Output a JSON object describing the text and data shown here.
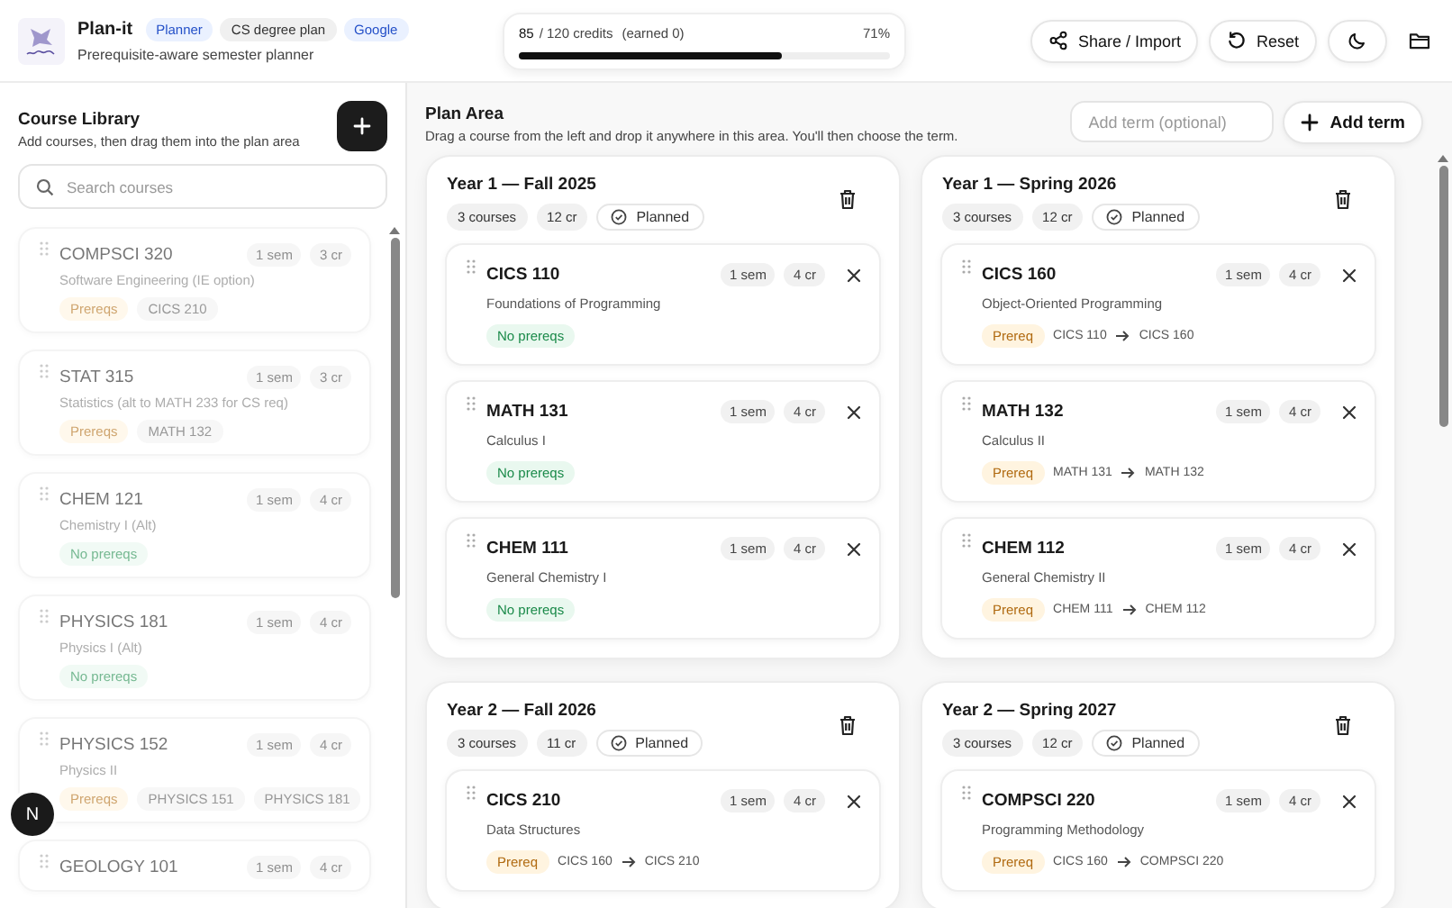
{
  "header": {
    "title": "Plan-it",
    "tags": [
      {
        "label": "Planner",
        "kind": "accent"
      },
      {
        "label": "CS degree plan",
        "kind": "plain"
      },
      {
        "label": "Google",
        "kind": "accent"
      }
    ],
    "subtitle": "Prerequisite-aware semester planner"
  },
  "credits": {
    "planned": "85",
    "total": "/ 120 credits",
    "earned": "(earned 0)",
    "percent": "71%",
    "level": 0.71
  },
  "actions": {
    "share": "Share / Import",
    "reset": "Reset"
  },
  "library": {
    "title": "Course Library",
    "subtitle": "Add courses, then drag them into the plan area",
    "search_placeholder": "Search courses",
    "courses": [
      {
        "code": "COMPSCI 320",
        "sem": "1 sem",
        "credits": "3 cr",
        "name": "Software Engineering (IE option)",
        "prereq": {
          "kind": "list",
          "label": "Prereqs",
          "items": [
            "CICS 210"
          ]
        }
      },
      {
        "code": "STAT 315",
        "sem": "1 sem",
        "credits": "3 cr",
        "name": "Statistics (alt to MATH 233 for CS req)",
        "prereq": {
          "kind": "list",
          "label": "Prereqs",
          "items": [
            "MATH 132"
          ]
        }
      },
      {
        "code": "CHEM 121",
        "sem": "1 sem",
        "credits": "4 cr",
        "name": "Chemistry I (Alt)",
        "prereq": {
          "kind": "none",
          "label": "No prereqs"
        }
      },
      {
        "code": "PHYSICS 181",
        "sem": "1 sem",
        "credits": "4 cr",
        "name": "Physics I (Alt)",
        "prereq": {
          "kind": "none",
          "label": "No prereqs"
        }
      },
      {
        "code": "PHYSICS 152",
        "sem": "1 sem",
        "credits": "4 cr",
        "name": "Physics II",
        "prereq": {
          "kind": "list",
          "label": "Prereqs",
          "items": [
            "PHYSICS 151",
            "PHYSICS 181"
          ]
        }
      },
      {
        "code": "GEOLOGY 101",
        "sem": "1 sem",
        "credits": "4 cr"
      }
    ]
  },
  "avatar": "N",
  "plan": {
    "title": "Plan Area",
    "subtitle": "Drag a course from the left and drop it anywhere in this area. You'll then choose the term.",
    "term_placeholder": "Add term (optional)",
    "add_term": "Add term",
    "terms": [
      {
        "title": "Year 1 — Fall 2025",
        "count": "3 courses",
        "credits": "12 cr",
        "status": "Planned",
        "courses": [
          {
            "code": "CICS 110",
            "sem": "1 sem",
            "credits": "4 cr",
            "name": "Foundations of Programming",
            "prereq": {
              "kind": "none",
              "label": "No prereqs"
            }
          },
          {
            "code": "MATH 131",
            "sem": "1 sem",
            "credits": "4 cr",
            "name": "Calculus I",
            "prereq": {
              "kind": "none",
              "label": "No prereqs"
            }
          },
          {
            "code": "CHEM 111",
            "sem": "1 sem",
            "credits": "4 cr",
            "name": "General Chemistry I",
            "prereq": {
              "kind": "none",
              "label": "No prereqs"
            }
          }
        ]
      },
      {
        "title": "Year 1 — Spring 2026",
        "count": "3 courses",
        "credits": "12 cr",
        "status": "Planned",
        "courses": [
          {
            "code": "CICS 160",
            "sem": "1 sem",
            "credits": "4 cr",
            "name": "Object-Oriented Programming",
            "prereq": {
              "kind": "chain",
              "label": "Prereq",
              "from": "CICS 110",
              "to": "CICS 160"
            }
          },
          {
            "code": "MATH 132",
            "sem": "1 sem",
            "credits": "4 cr",
            "name": "Calculus II",
            "prereq": {
              "kind": "chain",
              "label": "Prereq",
              "from": "MATH 131",
              "to": "MATH 132"
            }
          },
          {
            "code": "CHEM 112",
            "sem": "1 sem",
            "credits": "4 cr",
            "name": "General Chemistry II",
            "prereq": {
              "kind": "chain",
              "label": "Prereq",
              "from": "CHEM 111",
              "to": "CHEM 112"
            }
          }
        ]
      },
      {
        "title": "Year 2 — Fall 2026",
        "count": "3 courses",
        "credits": "11 cr",
        "status": "Planned",
        "courses": [
          {
            "code": "CICS 210",
            "sem": "1 sem",
            "credits": "4 cr",
            "name": "Data Structures",
            "prereq": {
              "kind": "chain",
              "label": "Prereq",
              "from": "CICS 160",
              "to": "CICS 210"
            }
          }
        ]
      },
      {
        "title": "Year 2 — Spring 2027",
        "count": "3 courses",
        "credits": "12 cr",
        "status": "Planned",
        "courses": [
          {
            "code": "COMPSCI 220",
            "sem": "1 sem",
            "credits": "4 cr",
            "name": "Programming Methodology",
            "prereq": {
              "kind": "chain",
              "label": "Prereq",
              "from": "CICS 160",
              "to": "COMPSCI 220"
            }
          }
        ]
      }
    ]
  }
}
